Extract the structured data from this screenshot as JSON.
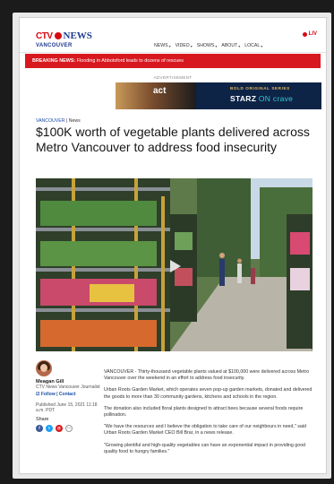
{
  "header": {
    "logo_ctv": "CTV",
    "logo_news": "NEWS",
    "logo_city": "VANCOUVER",
    "live_label": "LIV",
    "nav": [
      {
        "label": "NEWS"
      },
      {
        "label": "VIDEO"
      },
      {
        "label": "SHOWS"
      },
      {
        "label": "ABOUT"
      },
      {
        "label": "LOCAL"
      }
    ]
  },
  "breaking": {
    "prefix": "BREAKING NEWS:",
    "text": " Flooding in Abbotsford leads to dozens of rescues"
  },
  "ad": {
    "label": "ADVERTISEMENT",
    "left_text": "act",
    "tagline": "BOLD ORIGINAL SERIES",
    "brand": "STARZ",
    "brand_on": " ON ",
    "brand_crave": "crave"
  },
  "article": {
    "section": "VANCOUVER",
    "section_sep": " | News",
    "title": "$100K worth of vegetable plants delivered across Metro Vancouver to address food insecurity",
    "author_name": "Meagan Gill",
    "author_role": "CTV News Vancouver Journalist",
    "follow": "Follow",
    "contact": "Contact",
    "published": "Published June 15, 2021 11:18 a.m. PDT",
    "share_label": "Share",
    "paragraphs": [
      "VANCOUVER - Thirty-thousand vegetable plants valued at $100,000 were delivered across Metro Vancouver over the weekend in an effort to address food insecurity.",
      "Urban Roots Garden Market, which operates seven pop-up garden markets, donated and delivered the goods to more than 30 community gardens, kitchens and schools in the region.",
      "The donation also included floral plants designed to attract bees because several foods require pollination.",
      "\"We have the resources and I believe the obligation to take care of our neighbours in need,\" said Urban Roots Garden Market CEO Bill Brar, in a news release.",
      "\"Growing plentiful and high-quality vegetables can have an exponential impact in providing good quality food to hungry families.\""
    ]
  },
  "colors": {
    "brand_red": "#d60c12",
    "brand_blue": "#1a3a8f",
    "breaking_bg": "#d8181f",
    "link_blue": "#1a4fa6"
  },
  "icons": {
    "play": "play-icon",
    "share": [
      "facebook-icon",
      "twitter-icon",
      "email-icon",
      "more-icon"
    ]
  }
}
